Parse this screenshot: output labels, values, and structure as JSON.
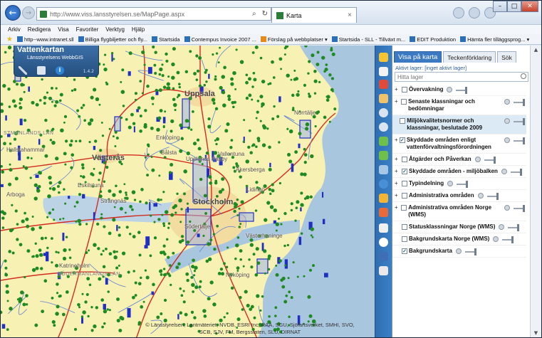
{
  "browser": {
    "url": "http://www.viss.lansstyrelsen.se/MapPage.aspx",
    "tab_title": "Karta"
  },
  "menu": [
    "Arkiv",
    "Redigera",
    "Visa",
    "Favoriter",
    "Verktyg",
    "Hjälp"
  ],
  "favorites": [
    {
      "label": "http--www.intranet.sll",
      "icon": "page-icon"
    },
    {
      "label": "Billiga flygbiljetter och fly...",
      "icon": "airline-icon"
    },
    {
      "label": "Startsida",
      "icon": "page-icon"
    },
    {
      "label": "Contempus Invoice 2007 ...",
      "icon": "page-icon"
    },
    {
      "label": "Förslag på webbplatser ▾",
      "icon": "suggest-icon"
    },
    {
      "label": "Startsida - SLL - Tillväxt m...",
      "icon": "page-icon"
    },
    {
      "label": "EDIT Produktion",
      "icon": "page-icon"
    },
    {
      "label": "Hämta fler tilläggsprog... ▾",
      "icon": "page-icon"
    }
  ],
  "app": {
    "title": "Vattenkartan",
    "subtitle": "Länsstyrelsens WebbGIS",
    "version": "1.4.2"
  },
  "map_labels": {
    "uppsala": "Uppsala",
    "vasteras": "Västerås",
    "eskilstuna": "Eskilstuna",
    "stockholm": "Stockholm",
    "sodertalje": "Södertälje",
    "norrtalje": "Norrtälje",
    "enkoping": "Enköping",
    "balsta": "Bålsta",
    "sigtuna": "Upplands Väsby",
    "vallentuna": "Vallentuna",
    "akersberga": "Åkersberga",
    "lidingo": "Lidingö",
    "strangnas": "Strängnäs",
    "hallstahammar": "Hallstahammar",
    "arboga": "Arboga",
    "katrineholm": "Katrineholm",
    "nykoping": "Nyköping",
    "haninge": "Västerhaninge",
    "region_vastmanland": "STMANLANDS LÄN",
    "region_sodermanland": "SÖDERMANLANDS LÄN",
    "copyright": "© Länsstyrelsen, Lantmäteriet, NVDB, ESRI Inc, RAÄ, SGU, Sjöfartsverket, SMHI, SVO, SCB, SJV, FM, Bergsstaten, SLU, DIRNAT"
  },
  "panel": {
    "tabs": [
      "Visa på karta",
      "Teckenförklaring",
      "Sök"
    ],
    "active_tab": "Visa på karta",
    "active_layer_text": "Aktivt lager: [inget aktivt lager]",
    "search_placeholder": "Hitta lager",
    "layers": [
      {
        "name": "Övervakning",
        "checked": false,
        "expandable": true
      },
      {
        "name": "Senaste klassningar och bedömningar",
        "checked": false,
        "expandable": true
      },
      {
        "name": "Miljökvalitetsnormer och klassningar, beslutade 2009",
        "checked": false,
        "expandable": false,
        "highlighted": true
      },
      {
        "name": "Skyddade områden enligt vattenförvaltningsförordningen",
        "checked": true,
        "expandable": true
      },
      {
        "name": "Åtgärder och Påverkan",
        "checked": false,
        "expandable": true
      },
      {
        "name": "Skyddade områden - miljöbalken",
        "checked": true,
        "expandable": true
      },
      {
        "name": "Typindelning",
        "checked": false,
        "expandable": true
      },
      {
        "name": "Administrativa områden",
        "checked": false,
        "expandable": true
      },
      {
        "name": "Administrativa områden Norge (WMS)",
        "checked": false,
        "expandable": true
      },
      {
        "name": "Statusklassningar Norge (WMS)",
        "checked": false,
        "expandable": false
      },
      {
        "name": "Bakgrundskarta Norge (WMS)",
        "checked": false,
        "expandable": false
      },
      {
        "name": "Bakgrundskarta",
        "checked": true,
        "expandable": false
      }
    ]
  },
  "colors": {
    "map_land": "#f7f1b3",
    "map_sea": "#a9c6df",
    "point_green": "#1f8a22",
    "protected_blue": "#1f2fc4",
    "road_red": "#d42b1f",
    "panel_accent": "#3b79c3"
  }
}
